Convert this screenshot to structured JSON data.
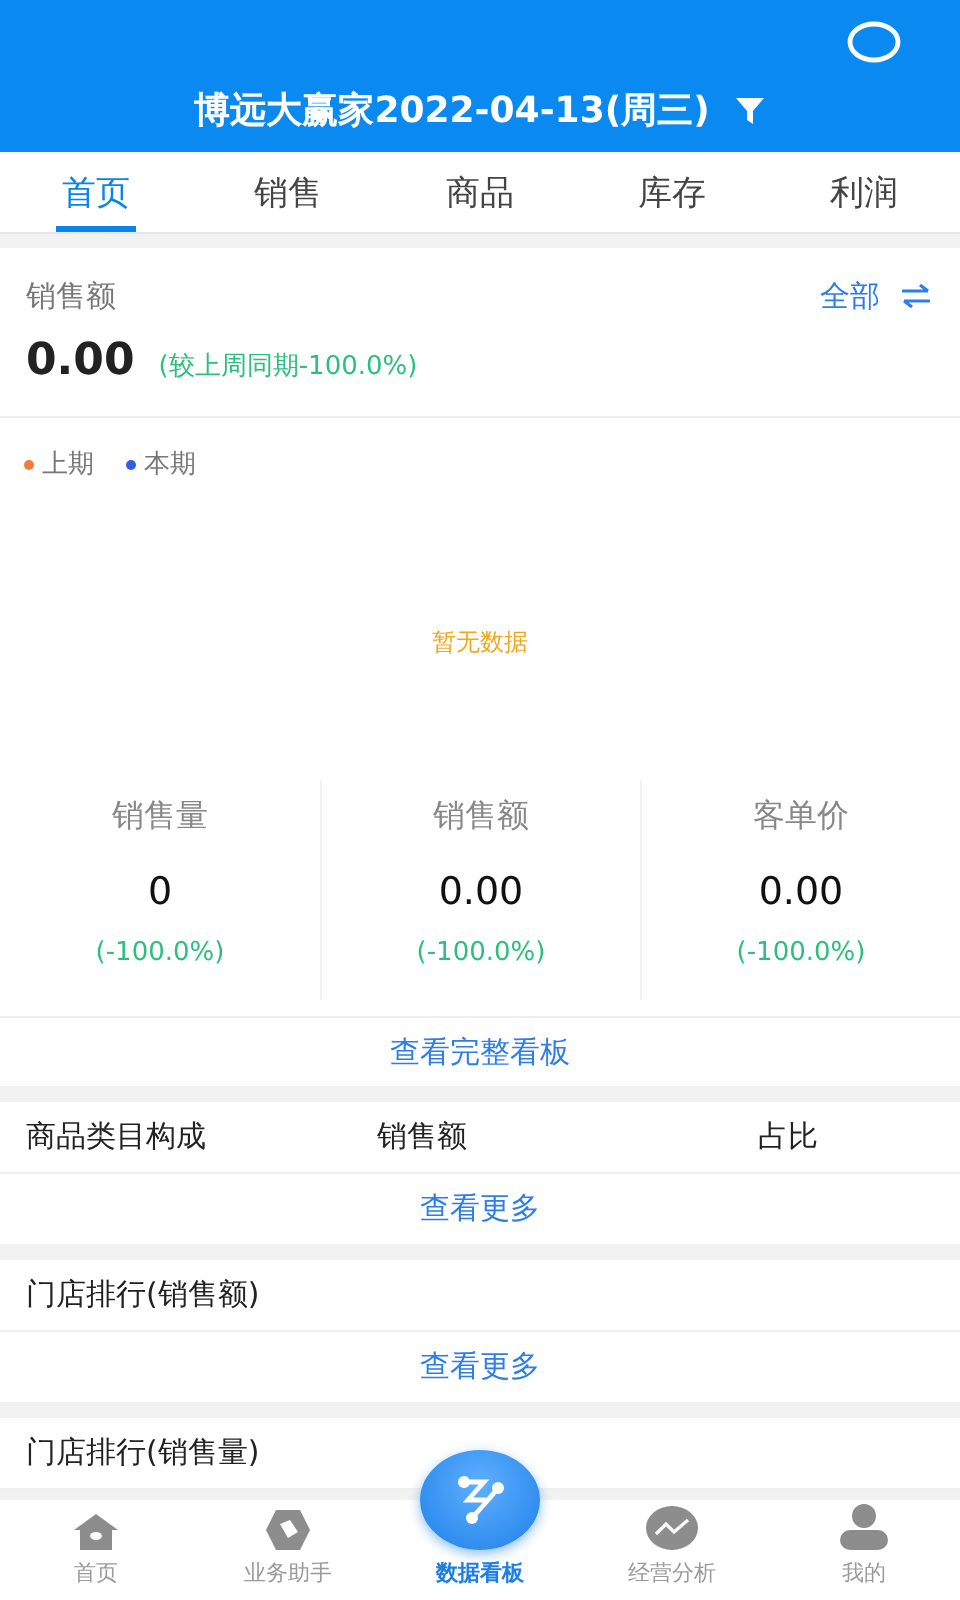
{
  "header": {
    "title": "博远大赢家2022-04-13(周三)"
  },
  "tabs": [
    {
      "label": "首页",
      "selected": true
    },
    {
      "label": "销售",
      "selected": false
    },
    {
      "label": "商品",
      "selected": false
    },
    {
      "label": "库存",
      "selected": false
    },
    {
      "label": "利润",
      "selected": false
    }
  ],
  "sales": {
    "label": "销售额",
    "scope": "全部",
    "value": "0.00",
    "change": "(较上周同期-100.0%)"
  },
  "chart": {
    "legend": [
      {
        "label": "上期",
        "color": "#f5793a"
      },
      {
        "label": "本期",
        "color": "#2f5ee8"
      }
    ],
    "empty_text": "暂无数据"
  },
  "stats": [
    {
      "label": "销售量",
      "value": "0",
      "change": "(-100.0%)"
    },
    {
      "label": "销售额",
      "value": "0.00",
      "change": "(-100.0%)"
    },
    {
      "label": "客单价",
      "value": "0.00",
      "change": "(-100.0%)"
    }
  ],
  "full_board_link": "查看完整看板",
  "category": {
    "columns": [
      "商品类目构成",
      "销售额",
      "占比"
    ],
    "more": "查看更多"
  },
  "store_rank_amount": {
    "title": "门店排行(销售额)",
    "more": "查看更多"
  },
  "store_rank_qty": {
    "title": "门店排行(销售量)"
  },
  "nav": [
    {
      "label": "首页",
      "kind": "home",
      "selected": false
    },
    {
      "label": "业务助手",
      "kind": "tag",
      "selected": false
    },
    {
      "label": "数据看板",
      "kind": "board",
      "selected": true
    },
    {
      "label": "经营分析",
      "kind": "trend",
      "selected": false
    },
    {
      "label": "我的",
      "kind": "user",
      "selected": false
    }
  ]
}
